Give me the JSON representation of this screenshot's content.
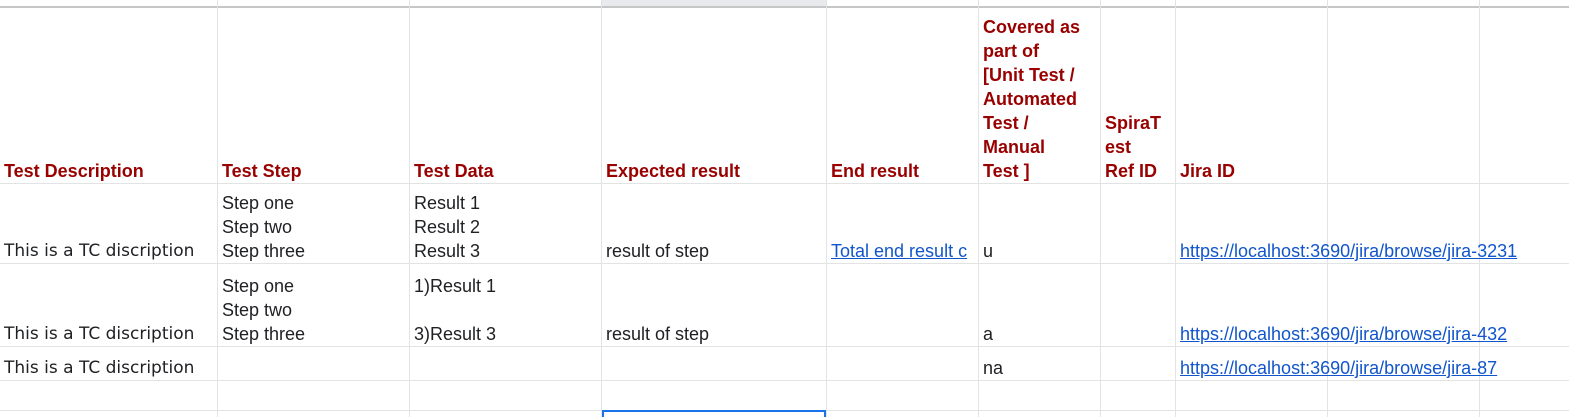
{
  "headers": {
    "test_description": "Test Description",
    "test_step": "Test Step",
    "test_data": "Test Data",
    "expected_result": "Expected result",
    "end_result": "End result",
    "covered_as": "Covered as\npart of\n[Unit Test /\nAutomated\nTest /\nManual\nTest ]",
    "spira_ref": "SpiraT\nest\nRef ID",
    "jira_id": "Jira ID"
  },
  "rows": [
    {
      "test_description": "This is a TC discription",
      "test_step": "Step one\nStep two\nStep three",
      "test_data": "Result 1\nResult 2\nResult 3",
      "expected_result": "result of step",
      "end_result": "Total end result c",
      "covered_as": "u",
      "spira_ref": "",
      "jira_id": "https://localhost:3690/jira/browse/jira-3231"
    },
    {
      "test_description": "This is a TC discription",
      "test_step": "Step one\nStep two\nStep three",
      "test_data": "1)Result 1\n\n3)Result 3",
      "expected_result": "result of step",
      "end_result": "",
      "covered_as": "a",
      "spira_ref": "",
      "jira_id": "https://localhost:3690/jira/browse/jira-432"
    },
    {
      "test_description": "This is a TC discription",
      "test_step": "",
      "test_data": "",
      "expected_result": "",
      "end_result": "",
      "covered_as": "na",
      "spira_ref": "",
      "jira_id": "https://localhost:3690/jira/browse/jira-87"
    }
  ]
}
